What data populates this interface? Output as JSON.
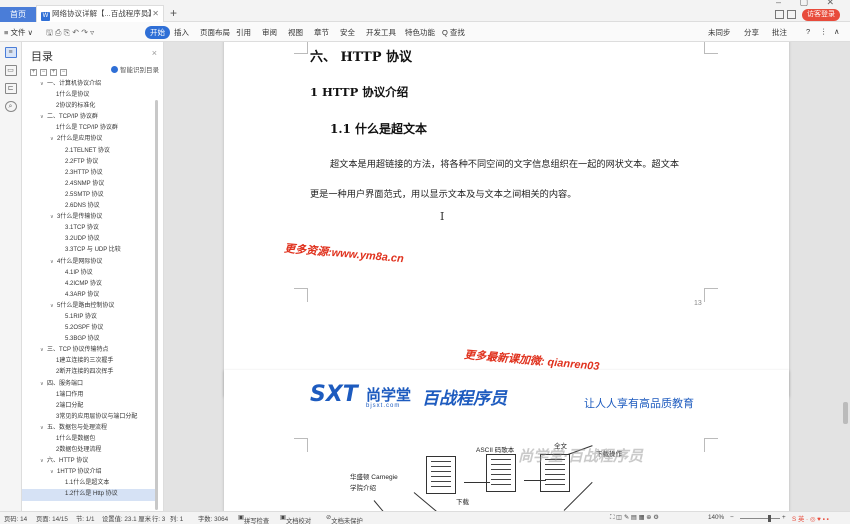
{
  "titlebar": {
    "home_tab": "首页",
    "doc_tab": "网络协议详解【...百战程序员】",
    "doc_tab_icon": "W",
    "new_tab": "+",
    "window_controls": "– ▢ ✕",
    "login_label": "访客登录"
  },
  "menu": {
    "file": "≡ 文件 ∨",
    "start": "开始",
    "items": [
      "插入",
      "页面布局",
      "引用",
      "审阅",
      "视图",
      "章节",
      "安全",
      "开发工具",
      "特色功能",
      "Q 查找"
    ],
    "right_items": [
      "未同步",
      "分享",
      "批注",
      "?",
      "⋮",
      "∧"
    ]
  },
  "outline": {
    "title": "目录",
    "close": "×",
    "smart_label": "智能识别目录",
    "items": [
      {
        "t": "一、计算机协议介绍",
        "lvl": 1,
        "arrow": "∨"
      },
      {
        "t": "1什么是协议",
        "lvl": 2
      },
      {
        "t": "2协议的标准化",
        "lvl": 2
      },
      {
        "t": "二、TCP/IP 协议群",
        "lvl": 1,
        "arrow": "∨"
      },
      {
        "t": "1什么是 TCP/IP 协议群",
        "lvl": 2
      },
      {
        "t": "2什么是应用协议",
        "lvl": 2,
        "arrow": "∨"
      },
      {
        "t": "2.1TELNET 协议",
        "lvl": 3
      },
      {
        "t": "2.2FTP 协议",
        "lvl": 3
      },
      {
        "t": "2.3HTTP 协议",
        "lvl": 3
      },
      {
        "t": "2.4SNMP 协议",
        "lvl": 3
      },
      {
        "t": "2.5SMTP 协议",
        "lvl": 3
      },
      {
        "t": "2.6DNS 协议",
        "lvl": 3
      },
      {
        "t": "3什么是传输协议",
        "lvl": 2,
        "arrow": "∨"
      },
      {
        "t": "3.1TCP 协议",
        "lvl": 3
      },
      {
        "t": "3.2UDP 协议",
        "lvl": 3
      },
      {
        "t": "3.3TCP 与 UDP 比较",
        "lvl": 3
      },
      {
        "t": "4什么是网际协议",
        "lvl": 2,
        "arrow": "∨"
      },
      {
        "t": "4.1IP 协议",
        "lvl": 3
      },
      {
        "t": "4.2ICMP 协议",
        "lvl": 3
      },
      {
        "t": "4.3ARP 协议",
        "lvl": 3
      },
      {
        "t": "5什么是路由控制协议",
        "lvl": 2,
        "arrow": "∨"
      },
      {
        "t": "5.1RIP 协议",
        "lvl": 3
      },
      {
        "t": "5.2OSPF 协议",
        "lvl": 3
      },
      {
        "t": "5.3BGP 协议",
        "lvl": 3
      },
      {
        "t": "三、TCP 协议传输特点",
        "lvl": 1,
        "arrow": "∨"
      },
      {
        "t": "1建立连接的三次握手",
        "lvl": 2
      },
      {
        "t": "2断开连接的四次挥手",
        "lvl": 2
      },
      {
        "t": "四、服务端口",
        "lvl": 1,
        "arrow": "∨"
      },
      {
        "t": "1端口作用",
        "lvl": 2
      },
      {
        "t": "2端口分配",
        "lvl": 2
      },
      {
        "t": "3常见的应用层协议与端口分配",
        "lvl": 2
      },
      {
        "t": "五、数据包与处理流程",
        "lvl": 1,
        "arrow": "∨"
      },
      {
        "t": "1什么是数据包",
        "lvl": 2
      },
      {
        "t": "2数据包处理流程",
        "lvl": 2
      },
      {
        "t": "六、HTTP 协议",
        "lvl": 1,
        "arrow": "∨"
      },
      {
        "t": "1HTTP 协议介绍",
        "lvl": 2,
        "arrow": "∨"
      },
      {
        "t": "1.1什么是超文本",
        "lvl": 3
      },
      {
        "t": "1.2什么是 Http 协议",
        "lvl": 3,
        "selected": true
      }
    ]
  },
  "document": {
    "h_six": "六、  HTTP 协议",
    "h_one": "1   HTTP 协议介绍",
    "h_oneone": "1.1 什么是超文本",
    "para_line1": "超文本是用超链接的方法，将各种不同空间的文字信息组织在一起的网状文本。超文本",
    "para_line2": "更是一种用户界面范式，用以显示文本及与文本之间相关的内容。",
    "page_number": "13",
    "watermark1": "更多资源:www.ym8a.cn",
    "watermark2": "更多最新课加微: qianren03",
    "brand_left": "SXT",
    "brand_cn": "尚学堂",
    "brand_url": "bjsxt.com",
    "brand_right": "百战程序员",
    "slogan": "让人人享有高品质教育",
    "diagram_labels": {
      "ascii": "ASCII 码歌本",
      "fulltext": "全文",
      "download": "下载操作",
      "carnegie1": "华盛顿 Carnegie",
      "carnegie2": "学院介绍",
      "down": "下载"
    },
    "bottom_watermark": "尚学堂·百战程序员"
  },
  "status": {
    "page": "页码: 14",
    "pages": "页面: 14/15",
    "section": "节: 1/1",
    "setting": "设置值: 23.1 厘米",
    "row": "行: 3",
    "col": "列: 1",
    "words": "字数: 3064",
    "spell": "拼写检查",
    "proof": "文档校对",
    "protect": "文档未保护",
    "zoom": "140%"
  },
  "colors": {
    "accent": "#2f6fd6",
    "watermark": "#e0321e",
    "brand": "#1d5bbf"
  }
}
